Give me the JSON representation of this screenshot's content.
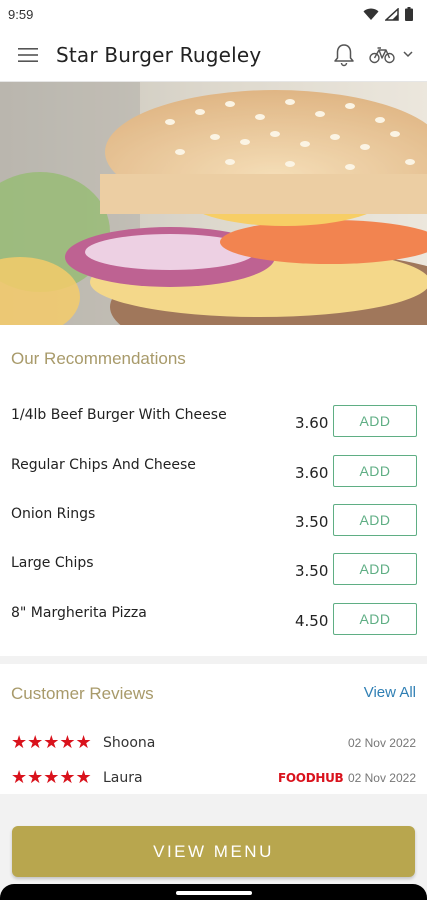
{
  "status_bar": {
    "time": "9:59"
  },
  "app_bar": {
    "title": "Star Burger Rugeley"
  },
  "recommendations": {
    "title": "Our Recommendations",
    "items": [
      {
        "name": "1/4lb Beef Burger With Cheese",
        "price": "3.60",
        "button": "ADD"
      },
      {
        "name": "Regular Chips And Cheese",
        "price": "3.60",
        "button": "ADD"
      },
      {
        "name": "Onion Rings",
        "price": "3.50",
        "button": "ADD"
      },
      {
        "name": "Large Chips",
        "price": "3.50",
        "button": "ADD"
      },
      {
        "name": "8\" Margherita Pizza",
        "price": "4.50",
        "button": "ADD"
      }
    ]
  },
  "reviews": {
    "title": "Customer Reviews",
    "view_all": "View All",
    "items": [
      {
        "stars": "★★★★★",
        "rating": 5,
        "name": "Shoona",
        "date": "02 Nov 2022",
        "source": ""
      },
      {
        "stars": "★★★★★",
        "rating": 5,
        "name": "Laura",
        "date": "02 Nov 2022",
        "source": "FOODHUB"
      }
    ]
  },
  "footer": {
    "view_menu": "VIEW MENU"
  },
  "colors": {
    "accent": "#b8a64e",
    "section_title": "#a89a6a",
    "add_green": "#5fae84",
    "link_blue": "#2f7fb4",
    "star_red": "#d9121c"
  },
  "icons": {
    "menu": "hamburger-icon",
    "bell": "bell-icon",
    "delivery": "bicycle-icon",
    "dropdown": "chevron-down-icon"
  }
}
